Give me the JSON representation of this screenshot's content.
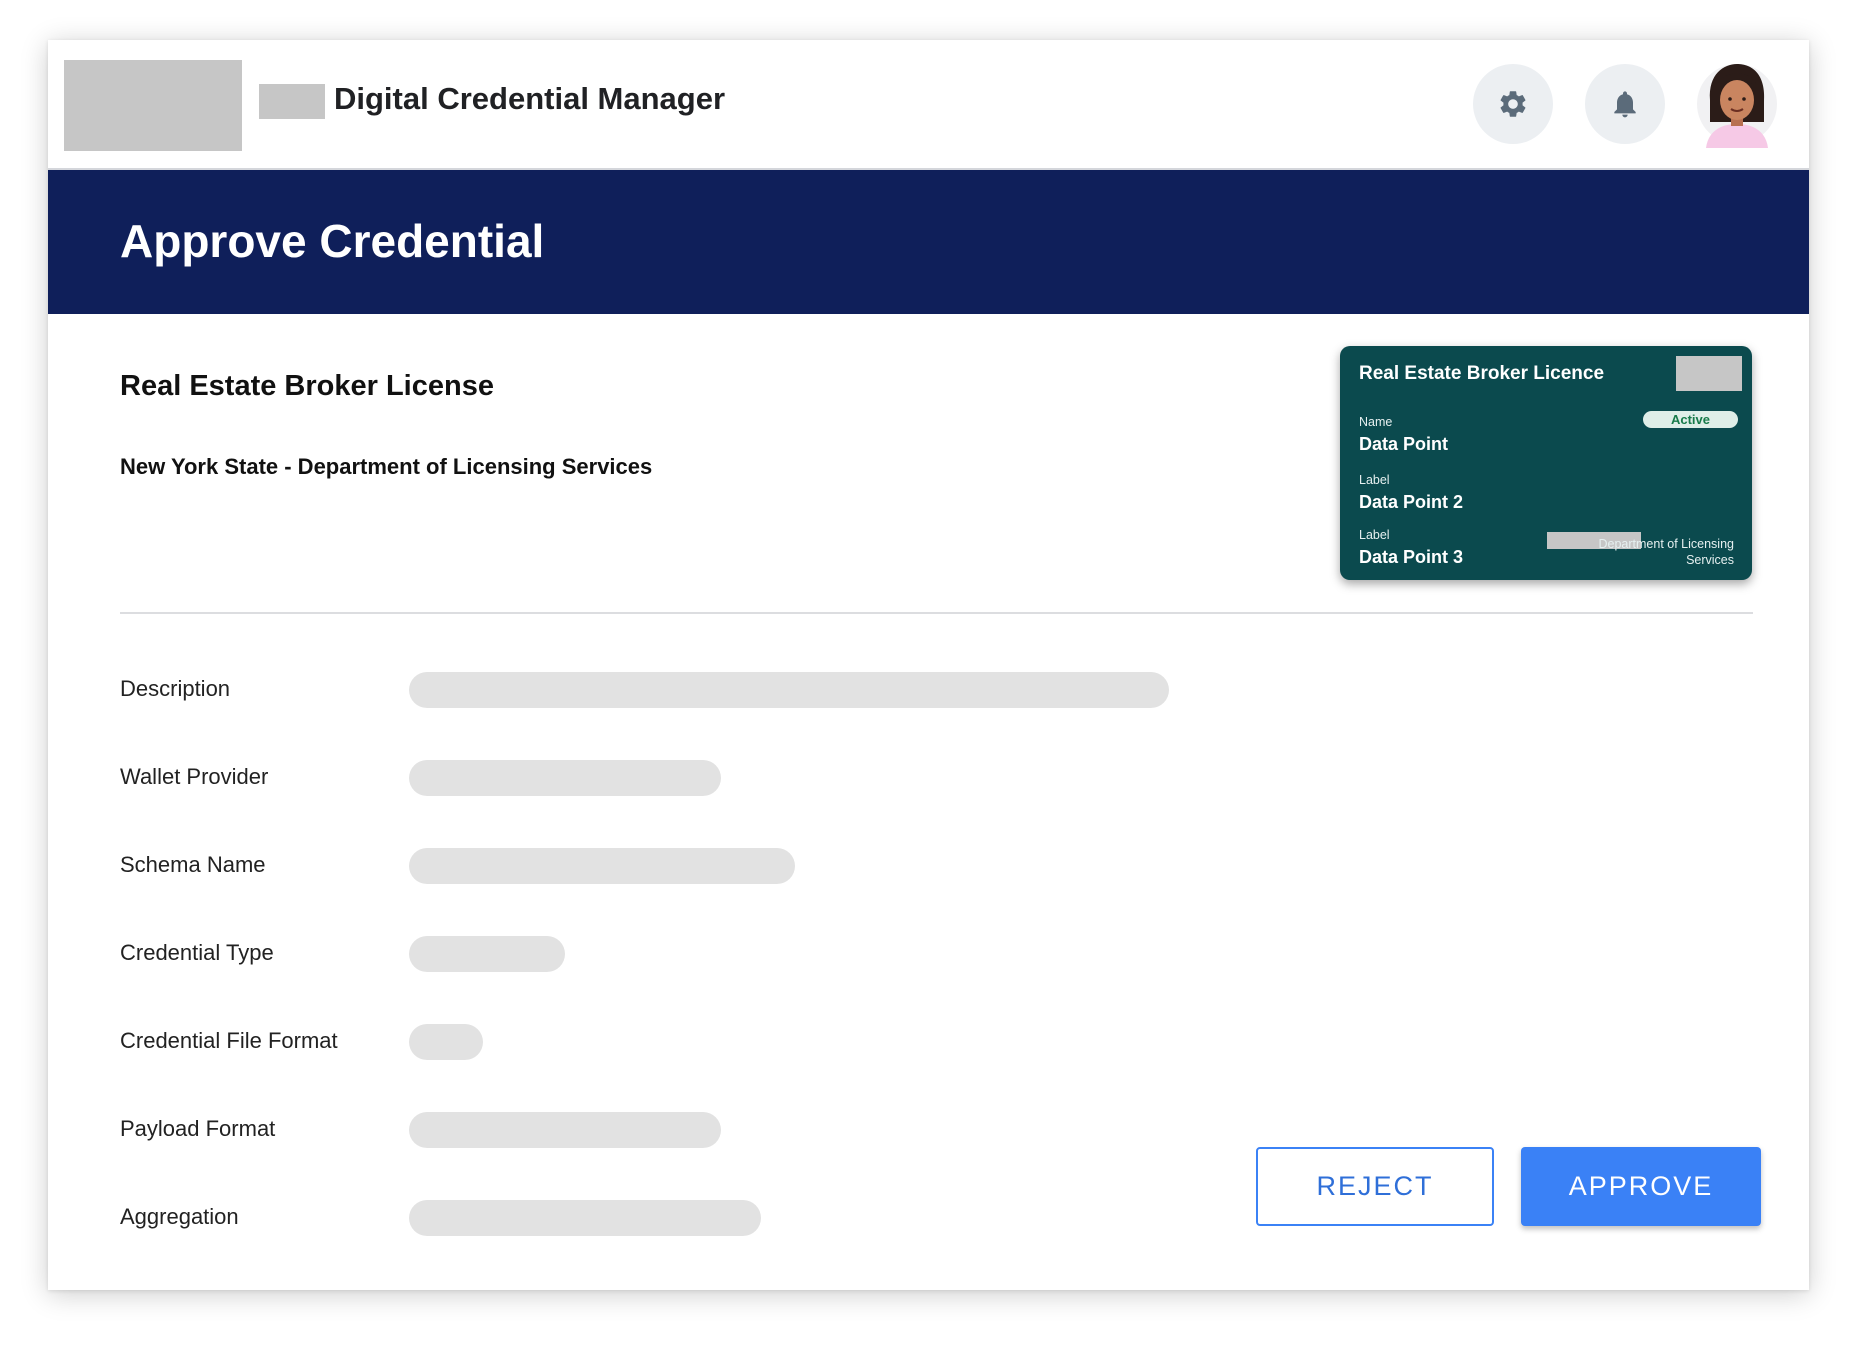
{
  "header": {
    "app_title": "Digital Credential Manager",
    "settings_icon": "gear-icon",
    "notifications_icon": "bell-icon",
    "avatar": "user-avatar"
  },
  "banner": {
    "title": "Approve Credential"
  },
  "credential": {
    "title": "Real Estate Broker License",
    "issuer": "New York State - Department of Licensing Services"
  },
  "card": {
    "title": "Real Estate Broker Licence",
    "status": "Active",
    "fields": [
      {
        "label": "Name",
        "value": "Data Point"
      },
      {
        "label": "Label",
        "value": "Data Point 2"
      },
      {
        "label": "Label",
        "value": "Data Point 3"
      }
    ],
    "issuer": "Department of Licensing Services",
    "background_color": "#0b4a4e"
  },
  "details": [
    {
      "label": "Description"
    },
    {
      "label": "Wallet Provider"
    },
    {
      "label": "Schema Name"
    },
    {
      "label": "Credential Type"
    },
    {
      "label": "Credential File Format"
    },
    {
      "label": "Payload Format"
    },
    {
      "label": "Aggregation"
    }
  ],
  "actions": {
    "reject_label": "REJECT",
    "approve_label": "APPROVE"
  },
  "colors": {
    "banner": "#0f1f5a",
    "primary": "#3a81f6"
  }
}
